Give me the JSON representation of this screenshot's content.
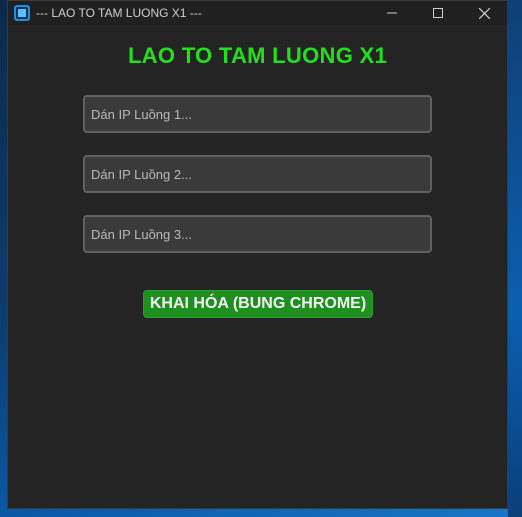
{
  "window": {
    "title": "--- LAO TO TAM LUONG X1 ---",
    "app_icon": "app-icon",
    "controls": [
      "minimize-icon",
      "maximize-icon",
      "close-icon"
    ]
  },
  "main": {
    "heading": "LAO TO TAM LUONG X1",
    "inputs": [
      {
        "placeholder": "Dán IP Luồng 1...",
        "value": ""
      },
      {
        "placeholder": "Dán IP Luồng 2...",
        "value": ""
      },
      {
        "placeholder": "Dán IP Luồng 3...",
        "value": ""
      }
    ],
    "activate_label": "KHAI HÓA (BUNG CHROME)"
  },
  "colors": {
    "heading": "#22e01a",
    "button_bg": "#1f8f1f",
    "window_bg": "#242424"
  }
}
